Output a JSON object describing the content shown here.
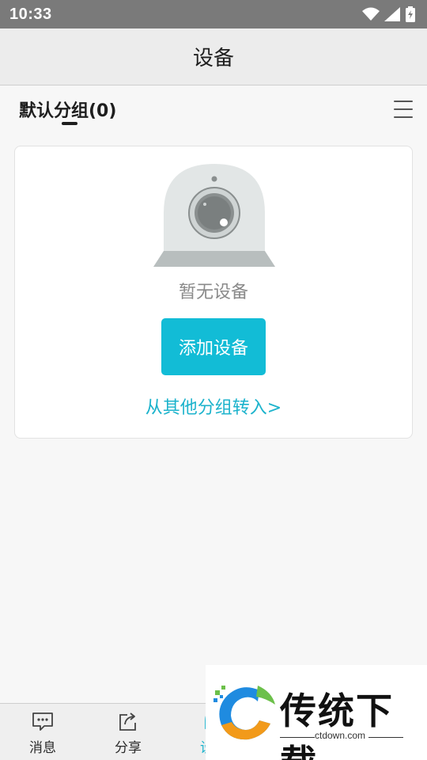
{
  "status_bar": {
    "time": "10:33",
    "icons": [
      "wifi-icon",
      "signal-icon",
      "battery-charging-icon"
    ]
  },
  "header": {
    "title": "设备"
  },
  "group_bar": {
    "tab_label": "默认分组(0)",
    "menu_icon": "menu-icon"
  },
  "empty_state": {
    "illustration": "camera-icon",
    "message": "暂无设备",
    "add_button_label": "添加设备",
    "transfer_link_label": "从其他分组转入>"
  },
  "tabbar": {
    "items": [
      {
        "label": "消息",
        "icon": "message-icon"
      },
      {
        "label": "分享",
        "icon": "share-icon"
      },
      {
        "label": "设备",
        "icon": "device-icon",
        "active": true
      }
    ]
  },
  "watermark": {
    "title": "传统下载",
    "url": "ctdown.com"
  },
  "colors": {
    "accent": "#12bcd6",
    "link": "#1cb3cc",
    "status_bar": "#7a7a7a",
    "header_bg": "#ececec"
  }
}
